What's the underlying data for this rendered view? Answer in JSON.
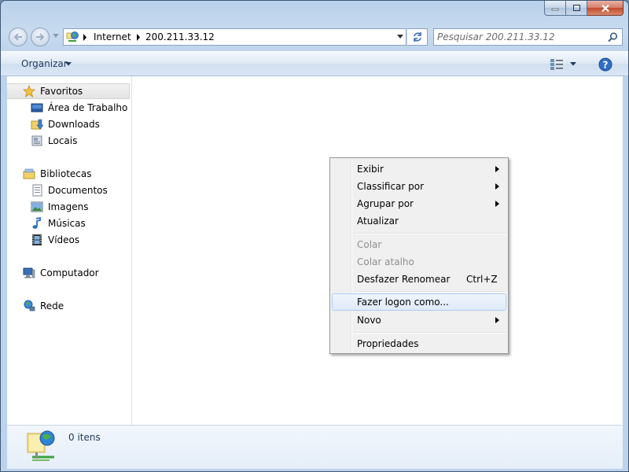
{
  "window": {
    "caption_buttons": [
      "minimize",
      "maximize",
      "close"
    ]
  },
  "address": {
    "crumbs": [
      "Internet",
      "200.211.33.12"
    ]
  },
  "search": {
    "placeholder": "Pesquisar 200.211.33.12"
  },
  "toolbar": {
    "organize_label": "Organizar"
  },
  "nav": {
    "favorites": {
      "label": "Favoritos",
      "items": [
        "Área de Trabalho",
        "Downloads",
        "Locais"
      ]
    },
    "libraries": {
      "label": "Bibliotecas",
      "items": [
        "Documentos",
        "Imagens",
        "Músicas",
        "Vídeos"
      ]
    },
    "computer": {
      "label": "Computador"
    },
    "network": {
      "label": "Rede"
    }
  },
  "status": {
    "items_count": "0 itens"
  },
  "context_menu": {
    "items": [
      {
        "label": "Exibir",
        "submenu": true
      },
      {
        "label": "Classificar por",
        "submenu": true
      },
      {
        "label": "Agrupar por",
        "submenu": true
      },
      {
        "label": "Atualizar"
      },
      {
        "label": "Colar",
        "disabled": true
      },
      {
        "label": "Colar atalho",
        "disabled": true
      },
      {
        "label": "Desfazer Renomear",
        "shortcut": "Ctrl+Z"
      },
      {
        "label": "Fazer logon como...",
        "highlighted": true
      },
      {
        "label": "Novo",
        "submenu": true
      },
      {
        "label": "Propriedades"
      }
    ]
  },
  "colors": {
    "frame": "#b9d1ea",
    "accent": "#1e395b",
    "selection": "#aecff7"
  }
}
